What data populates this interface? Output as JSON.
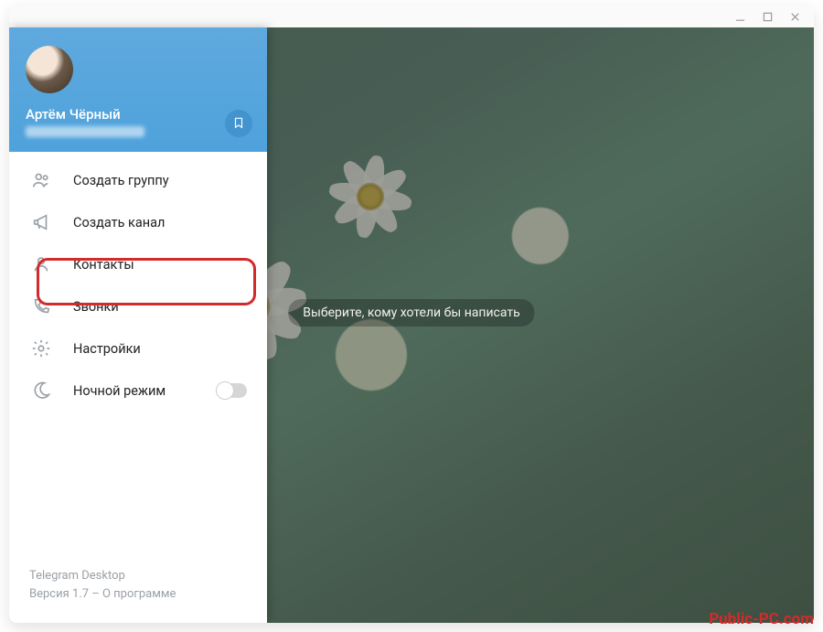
{
  "window": {
    "minimize": "–",
    "maximize": "□",
    "close": "×"
  },
  "header": {
    "username": "Артём Чёрный"
  },
  "menu": {
    "new_group": "Создать группу",
    "new_channel": "Создать канал",
    "contacts": "Контакты",
    "calls": "Звонки",
    "settings": "Настройки",
    "night_mode": "Ночной режим"
  },
  "footer": {
    "app_name": "Telegram Desktop",
    "version_prefix": "Версия 1.7",
    "about": "О программе"
  },
  "main": {
    "hint": "Выберите, кому хотели бы написать"
  },
  "watermark": "Public-PC.com"
}
